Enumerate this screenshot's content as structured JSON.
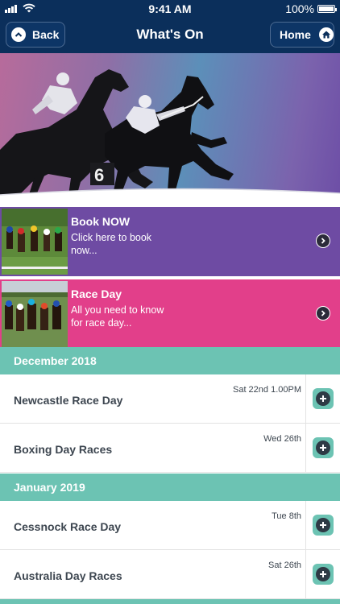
{
  "status_bar": {
    "time": "9:41 AM",
    "battery_text": "100%",
    "battery_level": 1.0,
    "signal_icon": "signal-bars-icon",
    "wifi_icon": "wifi-icon",
    "battery_icon": "battery-icon"
  },
  "nav": {
    "title": "What's On",
    "back_label": "Back",
    "home_label": "Home",
    "back_icon": "chevron-up-icon",
    "home_icon": "house-icon"
  },
  "promos": [
    {
      "title": "Book NOW",
      "description": "Click here to book now...",
      "color": "#6e4ba3"
    },
    {
      "title": "Race Day",
      "description": "All you need to know for race day...",
      "color": "#e23f8a"
    }
  ],
  "sections": [
    {
      "month": "December 2018",
      "events": [
        {
          "name": "Newcastle Race Day",
          "date": "Sat 22nd 1.00PM"
        },
        {
          "name": "Boxing Day Races",
          "date": "Wed 26th"
        }
      ]
    },
    {
      "month": "January 2019",
      "events": [
        {
          "name": "Cessnock Race Day",
          "date": "Tue 8th"
        },
        {
          "name": "Australia Day Races",
          "date": "Sat 26th"
        }
      ]
    }
  ],
  "colors": {
    "nav_background": "#0b2f5b",
    "section_header": "#6cc3b3",
    "book_now": "#6e4ba3",
    "race_day": "#e23f8a",
    "event_text": "#3d4650"
  }
}
